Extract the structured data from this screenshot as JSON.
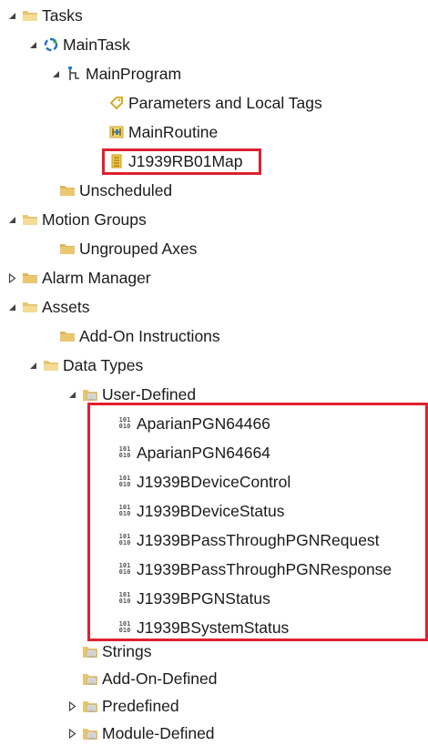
{
  "tree": {
    "tasks": "Tasks",
    "main_task": "MainTask",
    "main_program": "MainProgram",
    "parameters": "Parameters and Local Tags",
    "main_routine": "MainRoutine",
    "j1939_map": "J1939RB01Map",
    "unscheduled": "Unscheduled",
    "motion_groups": "Motion Groups",
    "ungrouped_axes": "Ungrouped Axes",
    "alarm_manager": "Alarm Manager",
    "assets": "Assets",
    "add_on_instructions": "Add-On Instructions",
    "data_types": "Data Types",
    "user_defined": "User-Defined",
    "udt": [
      "AparianPGN64466",
      "AparianPGN64664",
      "J1939BDeviceControl",
      "J1939BDeviceStatus",
      "J1939BPassThroughPGNRequest",
      "J1939BPassThroughPGNResponse",
      "J1939BPGNStatus",
      "J1939BSystemStatus"
    ],
    "strings": "Strings",
    "add_on_defined": "Add-On-Defined",
    "predefined": "Predefined",
    "module_defined": "Module-Defined"
  },
  "colors": {
    "highlight": "#e0202f",
    "folder": "#e8c670",
    "folder_dark": "#c9a24a"
  }
}
